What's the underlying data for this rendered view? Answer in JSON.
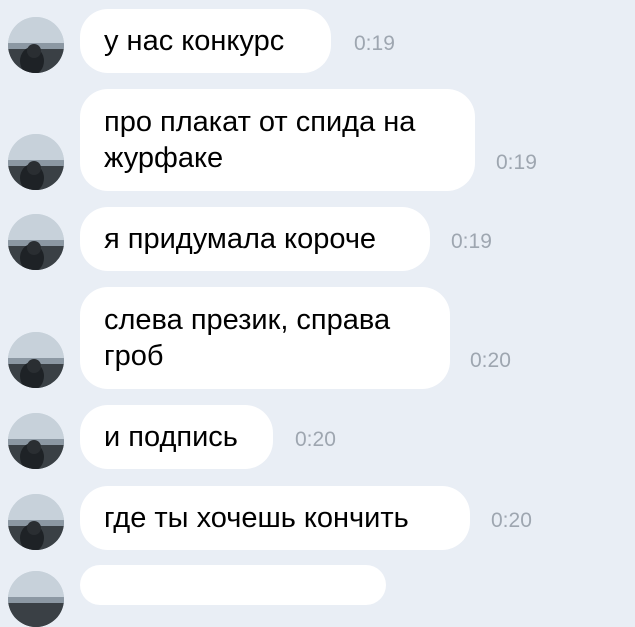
{
  "messages": [
    {
      "text": "у нас конкурс",
      "time": "0:19"
    },
    {
      "text": "про плакат от спида на\nжурфаке",
      "time": "0:19"
    },
    {
      "text": "я придумала короче",
      "time": "0:19"
    },
    {
      "text": "слева презик, справа\nгроб",
      "time": "0:20"
    },
    {
      "text": "и подпись",
      "time": "0:20"
    },
    {
      "text": "где ты хочешь кончить",
      "time": "0:20"
    }
  ],
  "icons": {
    "avatar": "user-avatar-photo"
  },
  "colors": {
    "background": "#e9eef5",
    "bubble": "#ffffff",
    "time": "#9ea6b0"
  }
}
